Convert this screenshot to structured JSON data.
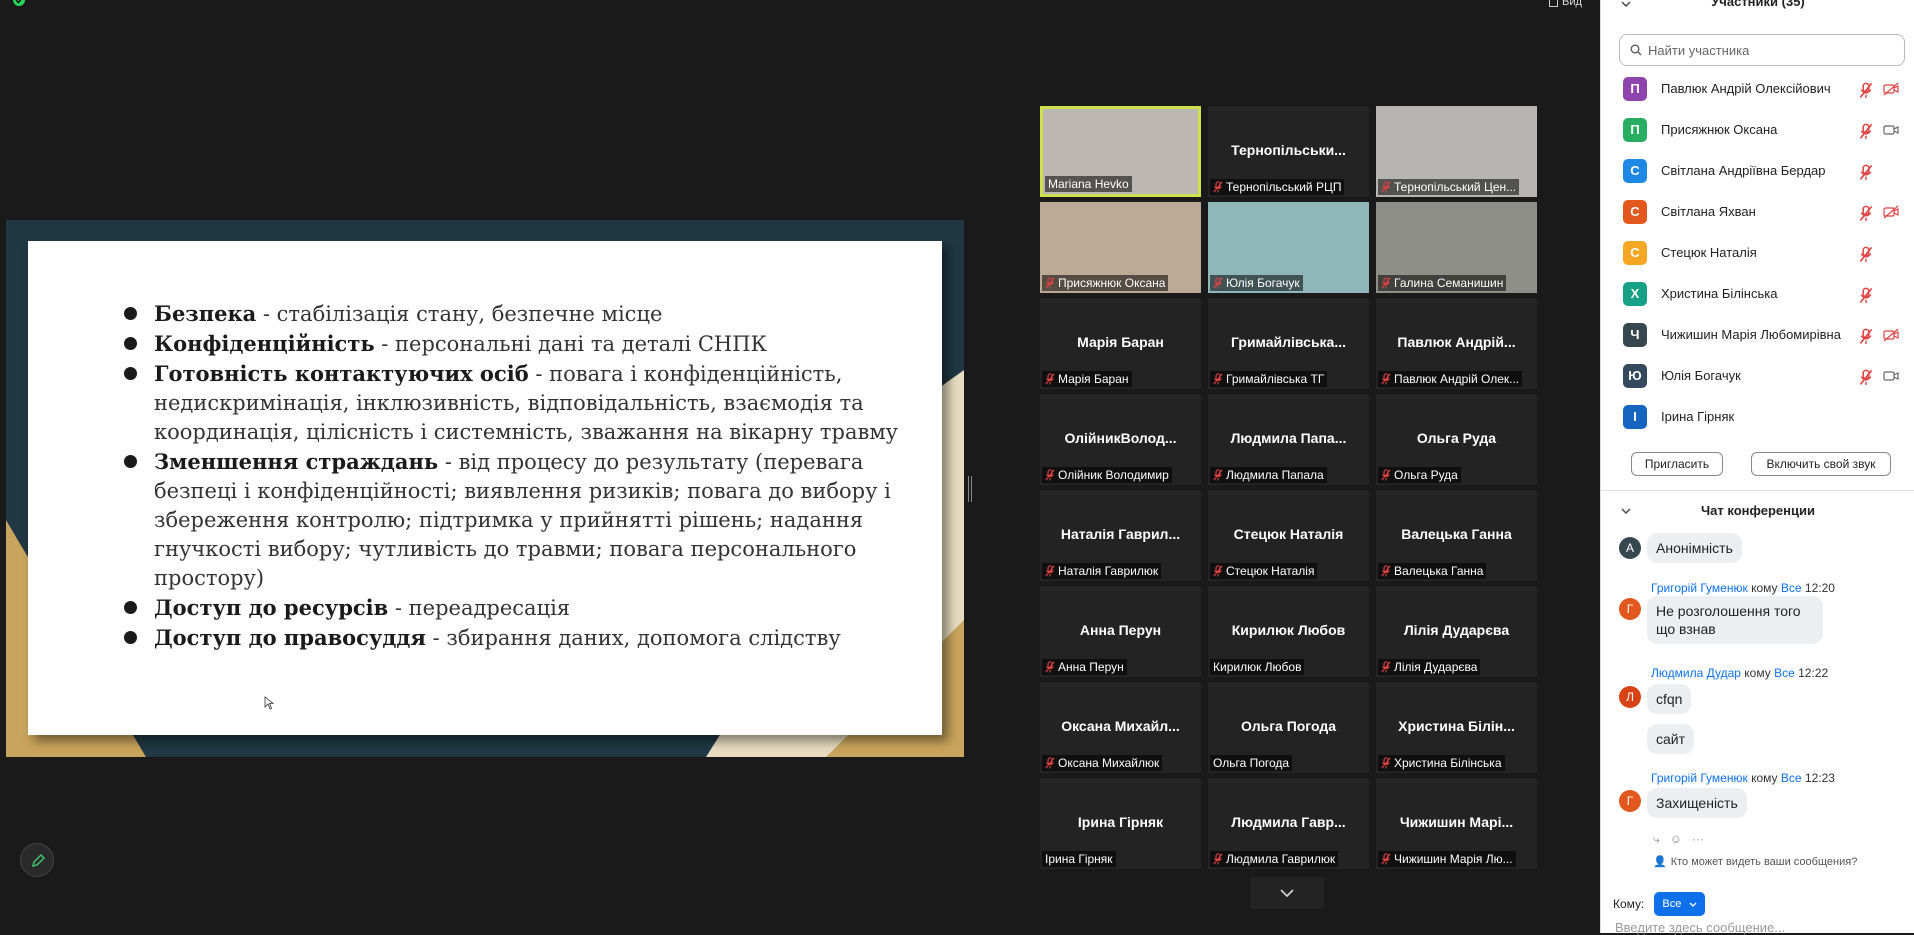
{
  "top": {
    "view_label": "Вид"
  },
  "slide": {
    "bullets": [
      {
        "bold": "Безпека",
        "rest": " - стабілізація стану, безпечне місце"
      },
      {
        "bold": "Конфіденційність",
        "rest": " - персональні дані та деталі СНПК"
      },
      {
        "bold": "Готовність контактуючих осіб",
        "rest": " - повага і конфіденційність, недискримінація, інклюзивність, відповідальність, взаємодія та координація, цілісність і системність, зважання на вікарну травму"
      },
      {
        "bold": "Зменшення страждань",
        "rest": " - від процесу до результату (перевага безпеці і конфіденційності;  виявлення ризиків;  повага до вибору і збереження контролю;  підтримка у прийнятті рішень;  надання гнучкості вибору;  чутливість до травми; повага персонального простору)"
      },
      {
        "bold": "Доступ до ресурсів",
        "rest": " - переадресація"
      },
      {
        "bold": "Доступ до правосуддя",
        "rest": " - збирання даних, допомога слідству"
      }
    ]
  },
  "tiles": [
    {
      "big": "",
      "label": "Mariana Hevko",
      "muted": false,
      "video": true,
      "active": true,
      "color": "#bdb7b3"
    },
    {
      "big": "Тернопільськи...",
      "label": "Тернопільський РЦП",
      "muted": true,
      "video": false
    },
    {
      "big": "",
      "label": "Тернопільський Цен...",
      "muted": true,
      "video": true,
      "color": "#b7b5b2"
    },
    {
      "big": "",
      "label": "Присяжнюк Оксана",
      "muted": true,
      "video": true,
      "color": "#bca996"
    },
    {
      "big": "",
      "label": "Юлія Богачук",
      "muted": true,
      "video": true,
      "color": "#8fb6b8"
    },
    {
      "big": "",
      "label": "Галина Семанишин",
      "muted": true,
      "video": true,
      "color": "#8e8f88"
    },
    {
      "big": "Марія Баран",
      "label": "Марія Баран",
      "muted": true,
      "video": false
    },
    {
      "big": "Гримайлівська...",
      "label": "Гримайлівська ТГ",
      "muted": true,
      "video": false
    },
    {
      "big": "Павлюк Андрій...",
      "label": "Павлюк Андрій Олек...",
      "muted": true,
      "video": false
    },
    {
      "big": "ОлійникВолод...",
      "label": "Олійник Володимир",
      "muted": true,
      "video": false
    },
    {
      "big": "Людмила Папа...",
      "label": "Людмила Папала",
      "muted": true,
      "video": false
    },
    {
      "big": "Ольга Руда",
      "label": "Ольга Руда",
      "muted": true,
      "video": false
    },
    {
      "big": "Наталія Гаврил...",
      "label": "Наталія Гаврилюк",
      "muted": true,
      "video": false
    },
    {
      "big": "Стецюк Наталія",
      "label": "Стецюк Наталія",
      "muted": true,
      "video": false
    },
    {
      "big": "Валецька Ганна",
      "label": "Валецька Ганна",
      "muted": true,
      "video": false
    },
    {
      "big": "Анна Перун",
      "label": "Анна Перун",
      "muted": true,
      "video": false
    },
    {
      "big": "Кирилюк Любов",
      "label": "Кирилюк Любов",
      "muted": false,
      "video": false
    },
    {
      "big": "Лілія Дударєва",
      "label": "Лілія Дударєва",
      "muted": true,
      "video": false
    },
    {
      "big": "Оксана Михайл...",
      "label": "Оксана Михайлюк",
      "muted": true,
      "video": false
    },
    {
      "big": "Ольга Погода",
      "label": "Ольга Погода",
      "muted": false,
      "video": false
    },
    {
      "big": "Христина Білін...",
      "label": "Христина Білінська",
      "muted": true,
      "video": false
    },
    {
      "big": "Ірина Гірняк",
      "label": "Ірина Гірняк",
      "muted": false,
      "video": false
    },
    {
      "big": "Людмила Гавр...",
      "label": "Людмила Гаврилюк",
      "muted": true,
      "video": false
    },
    {
      "big": "Чижишин Марі...",
      "label": "Чижишин Марія Лю...",
      "muted": true,
      "video": false
    }
  ],
  "participants": {
    "title": "Участники (35)",
    "search_placeholder": "Найти участника",
    "items": [
      {
        "initial": "П",
        "name": "Павлюк Андрій Олексійович",
        "color": "#8e44ad",
        "mic": "muted",
        "cam": "off"
      },
      {
        "initial": "П",
        "name": "Присяжнюк Оксана",
        "color": "#27ae60",
        "mic": "muted",
        "cam": "on"
      },
      {
        "initial": "С",
        "name": "Світлана Андріївна Бердар",
        "color": "#1e88e5",
        "mic": "muted",
        "cam": ""
      },
      {
        "initial": "С",
        "name": "Світлана Яхван",
        "color": "#e2571e",
        "mic": "muted",
        "cam": "off"
      },
      {
        "initial": "С",
        "name": "Стецюк Наталія",
        "color": "#f5a623",
        "mic": "muted",
        "cam": ""
      },
      {
        "initial": "Х",
        "name": "Христина Білінська",
        "color": "#16a085",
        "mic": "muted",
        "cam": ""
      },
      {
        "initial": "Ч",
        "name": "Чижишин Марія Любомирівна",
        "color": "#37474f",
        "mic": "muted",
        "cam": "off"
      },
      {
        "initial": "Ю",
        "name": "Юлія Богачук",
        "color": "#34495e",
        "mic": "muted",
        "cam": "on"
      },
      {
        "initial": "І",
        "name": "Ірина Гірняк",
        "color": "#1565c0",
        "mic": "",
        "cam": ""
      }
    ],
    "invite_label": "Пригласить",
    "unmute_label": "Включить свой звук"
  },
  "chat": {
    "title": "Чат конференции",
    "to_word": "кому",
    "messages": [
      {
        "text": "Анонімність",
        "initial": "А",
        "color": "#37474f"
      },
      {
        "sender": "Григорій Гуменюк",
        "to": "Все",
        "time": "12:20",
        "text": "Не розголошення того що взнав",
        "initial": "Г",
        "color": "#e2571e"
      },
      {
        "sender": "Людмила Дудар",
        "to": "Все",
        "time": "12:22",
        "text": "cfqn",
        "initial": "Л",
        "color": "#d84315"
      },
      {
        "text": "сайт"
      },
      {
        "sender": "Григорій Гуменюк",
        "to": "Все",
        "time": "12:23",
        "text": "Захищеність",
        "initial": "Г",
        "color": "#e2571e"
      }
    ],
    "who_can_see": "Кто может видеть ваши сообщения?",
    "to_label": "Кому:",
    "to_value": "Все",
    "input_placeholder": "Введите здесь сообщение..."
  }
}
